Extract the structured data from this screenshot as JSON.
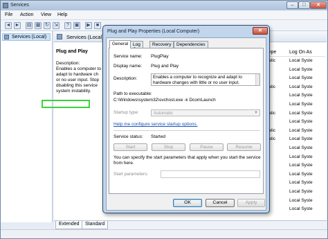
{
  "window": {
    "title": "Services",
    "controls": {
      "minimize": "–",
      "maximize": "□",
      "close": "✕"
    }
  },
  "menu": [
    "File",
    "Action",
    "View",
    "Help"
  ],
  "toolbar_icons": [
    "back-icon",
    "forward-icon",
    "show-hide-tree-icon",
    "properties-icon",
    "refresh-icon",
    "export-icon",
    "help-icon",
    "show-hide-action-icon",
    "play-icon",
    "stop-icon"
  ],
  "tree": {
    "root_label": "Services (Local)"
  },
  "right_pane": {
    "header": "Services (Local)",
    "service_name": "Plug and Play",
    "description_label": "Description:",
    "description_lines": [
      "Enables a computer to",
      "adapt to hardware ch",
      "or no user input. Stop",
      "disabling this service",
      "system instability."
    ],
    "columns": [
      "ype",
      "Log On As"
    ],
    "rows": [
      {
        "type": "atic",
        "logon": "Local Syste"
      },
      {
        "type": "",
        "logon": "Local Syste"
      },
      {
        "type": "",
        "logon": "Local Syste"
      },
      {
        "type": "atic",
        "logon": "Local Syste"
      },
      {
        "type": "",
        "logon": "Local Syste"
      },
      {
        "type": "",
        "logon": "Local Syste"
      },
      {
        "type": "atic",
        "logon": "Local Syste"
      },
      {
        "type": "",
        "logon": "Local Syste"
      },
      {
        "type": "atic",
        "logon": "Local Syste"
      },
      {
        "type": "atic",
        "logon": "Local Syste"
      },
      {
        "type": "",
        "logon": "Local Syste"
      },
      {
        "type": "",
        "logon": "Local Syste"
      },
      {
        "type": "",
        "logon": "Local Syste"
      },
      {
        "type": "",
        "logon": "Local Syste"
      },
      {
        "type": "",
        "logon": "Local Syste"
      },
      {
        "type": "",
        "logon": "Local Syste"
      },
      {
        "type": "",
        "logon": "Local Syste"
      },
      {
        "type": "",
        "logon": "Local Syste"
      }
    ],
    "bottom_tabs": [
      "Extended",
      "Standard"
    ]
  },
  "dialog": {
    "title": "Plug and Play Properties (Local Computer)",
    "close": "✕",
    "tabs": [
      "General",
      "Log On",
      "Recovery",
      "Dependencies"
    ],
    "service_name_label": "Service name:",
    "service_name_value": "PlugPlay",
    "display_name_label": "Display name:",
    "display_name_value": "Plug and Play",
    "description_label": "Description:",
    "description_value": "Enables a computer to recognize and adapt to hardware changes with little or no user input.",
    "path_label": "Path to executable:",
    "path_value": "C:\\Windows\\system32\\svchost.exe -k DcomLaunch",
    "startup_label": "Startup type:",
    "startup_value": "Automatic",
    "help_link": "Help me configure service startup options.",
    "status_label": "Service status:",
    "status_value": "Started",
    "buttons": {
      "start": "Start",
      "stop": "Stop",
      "pause": "Pause",
      "resume": "Resume"
    },
    "params_note": "You can specify the start parameters that apply when you start the service from here.",
    "params_label": "Start parameters:",
    "params_value": "",
    "footer": {
      "ok": "OK",
      "cancel": "Cancel",
      "apply": "Apply"
    }
  }
}
